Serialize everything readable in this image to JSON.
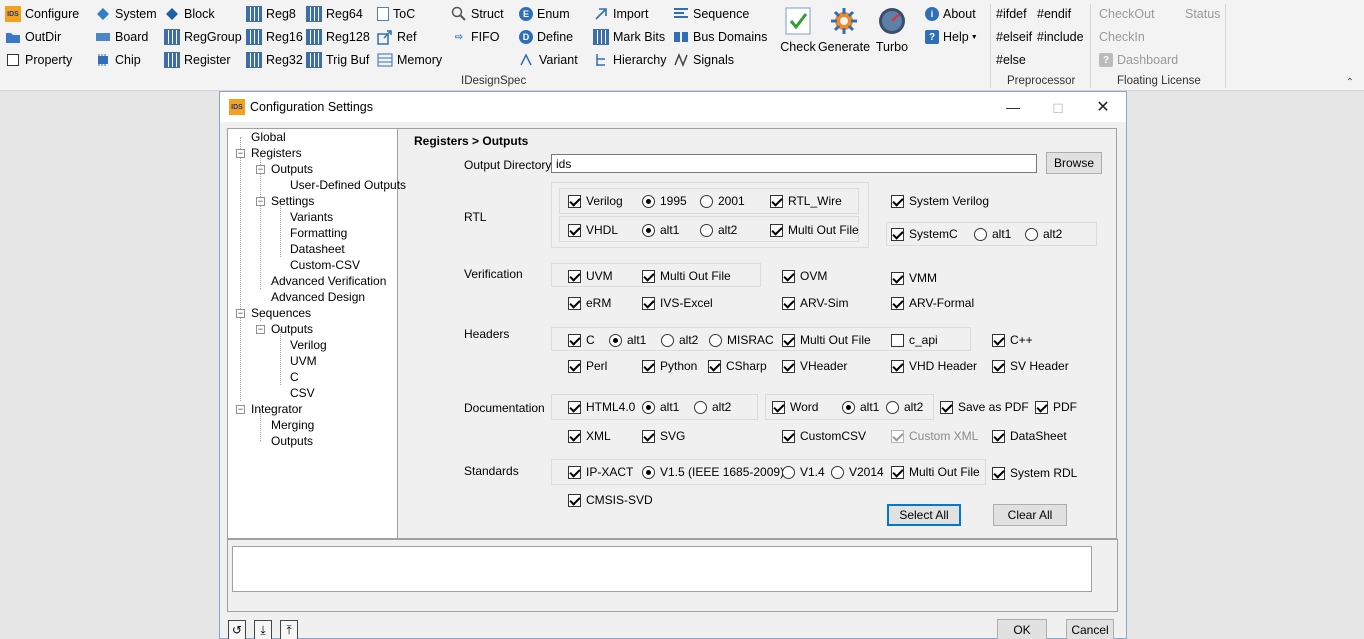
{
  "ribbon": {
    "col1": [
      "Configure",
      "OutDir",
      "Property"
    ],
    "col2": [
      "System",
      "Board",
      "Chip"
    ],
    "col3": [
      "Block",
      "RegGroup",
      "Register"
    ],
    "col4": [
      "Reg8",
      "Reg16",
      "Reg32"
    ],
    "col5": [
      "Reg64",
      "Reg128",
      "Trig Buf"
    ],
    "col6": [
      "ToC",
      "Ref",
      "Memory"
    ],
    "col7": [
      "Struct",
      "FIFO"
    ],
    "col8": [
      "Enum",
      "Define",
      "Variant"
    ],
    "col9": [
      "Import",
      "Mark Bits",
      "Hierarchy"
    ],
    "col10": [
      "Sequence",
      "Bus Domains",
      "Signals"
    ],
    "big": [
      "Check",
      "Generate",
      "Turbo"
    ],
    "col11": [
      "About",
      "Help"
    ],
    "pre": [
      "#ifdef",
      "#endif",
      "#elseif",
      "#include",
      "#else"
    ],
    "lic": [
      "CheckOut",
      "Status",
      "CheckIn",
      "Dashboard"
    ],
    "groups": {
      "idesignspec": "IDesignSpec",
      "preprocessor": "Preprocessor",
      "license": "Floating License"
    }
  },
  "dialog": {
    "title": "Configuration Settings",
    "icon_text": "IDS",
    "tree": {
      "global": "Global",
      "registers": "Registers",
      "outputs": "Outputs",
      "user_defined": "User-Defined Outputs",
      "settings": "Settings",
      "variants": "Variants",
      "formatting": "Formatting",
      "datasheet": "Datasheet",
      "custom_csv": "Custom-CSV",
      "adv_verif": "Advanced Verification",
      "adv_design": "Advanced Design",
      "sequences": "Sequences",
      "seq_outputs": "Outputs",
      "verilog": "Verilog",
      "uvm": "UVM",
      "c": "C",
      "csv": "CSV",
      "integrator": "Integrator",
      "merging": "Merging",
      "int_outputs": "Outputs"
    },
    "heading": "Registers > Outputs",
    "output_directory": {
      "label": "Output Directory",
      "value": "ids",
      "browse": "Browse"
    },
    "rtl": {
      "label": "RTL",
      "verilog": "Verilog",
      "v1995": "1995",
      "v2001": "2001",
      "rtl_wire": "RTL_Wire",
      "vhdl": "VHDL",
      "alt1": "alt1",
      "alt2": "alt2",
      "multi_out": "Multi Out File",
      "system_verilog": "System Verilog",
      "systemc": "SystemC",
      "sc_alt1": "alt1",
      "sc_alt2": "alt2"
    },
    "verification": {
      "label": "Verification",
      "uvm": "UVM",
      "multi_out": "Multi Out File",
      "ovm": "OVM",
      "vmm": "VMM",
      "erm": "eRM",
      "ivs_excel": "IVS-Excel",
      "arv_sim": "ARV-Sim",
      "arv_formal": "ARV-Formal"
    },
    "headers": {
      "label": "Headers",
      "c": "C",
      "alt1": "alt1",
      "alt2": "alt2",
      "misrac": "MISRAC",
      "multi_out": "Multi Out File",
      "c_api": "c_api",
      "cpp": "C++",
      "perl": "Perl",
      "python": "Python",
      "csharp": "CSharp",
      "vheader": "VHeader",
      "vhd_header": "VHD Header",
      "sv_header": "SV Header"
    },
    "documentation": {
      "label": "Documentation",
      "html": "HTML4.0",
      "alt1": "alt1",
      "alt2": "alt2",
      "word": "Word",
      "w_alt1": "alt1",
      "w_alt2": "alt2",
      "save_pdf": "Save as PDF",
      "pdf": "PDF",
      "xml": "XML",
      "svg": "SVG",
      "custom_csv": "CustomCSV",
      "custom_xml": "Custom XML",
      "datasheet": "DataSheet"
    },
    "standards": {
      "label": "Standards",
      "ipxact": "IP-XACT",
      "v15": "V1.5 (IEEE 1685-2009)",
      "v14": "V1.4",
      "v2014": "V2014",
      "multi_out": "Multi Out File",
      "system_rdl": "System RDL",
      "cmsis": "CMSIS-SVD"
    },
    "select_all": "Select All",
    "clear_all": "Clear All",
    "ok": "OK",
    "cancel": "Cancel"
  },
  "colors": {
    "accent": "#0078d7",
    "app_icon": "#f4a120"
  }
}
